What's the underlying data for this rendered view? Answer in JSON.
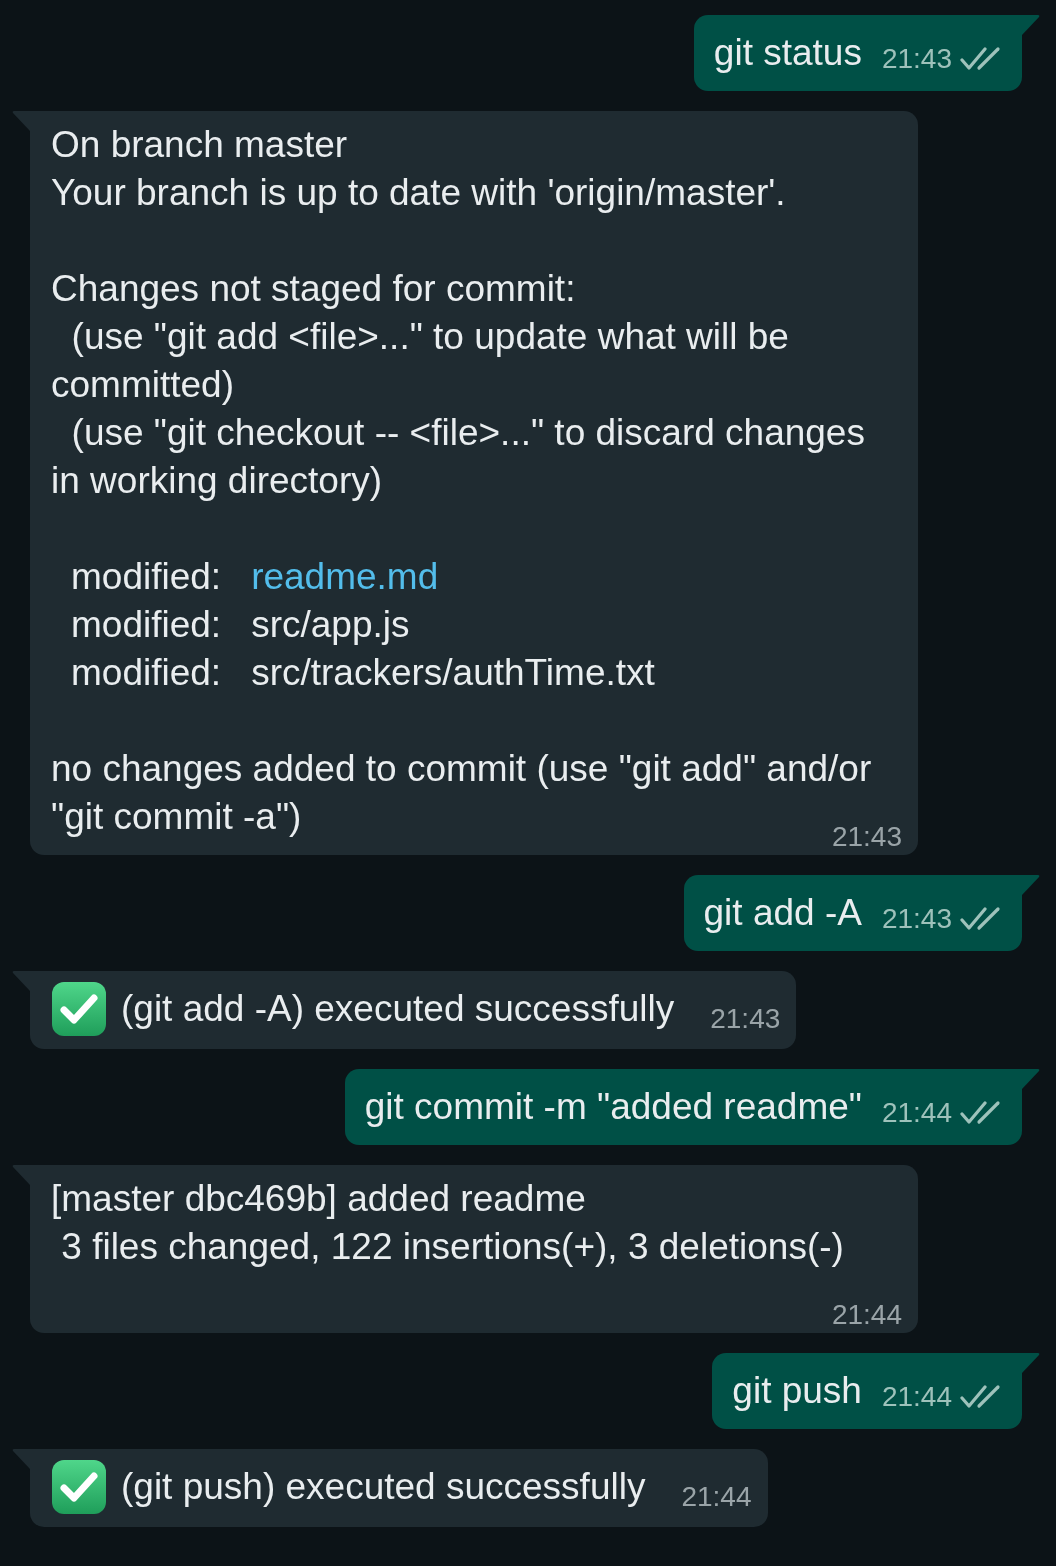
{
  "messages": [
    {
      "kind": "sent",
      "text": "git status",
      "time": "21:43",
      "read": false
    },
    {
      "kind": "received",
      "blocks": [
        {
          "kind": "text",
          "text": "On branch master\nYour branch is up to date with 'origin/master'."
        },
        {
          "kind": "text",
          "text": "Changes not staged for commit:\n  (use \"git add <file>...\" to update what will be committed)\n  (use \"git checkout -- <file>...\" to discard changes in working directory)"
        },
        {
          "kind": "files",
          "rows": [
            {
              "status": "modified:",
              "file": "readme.md",
              "link": true
            },
            {
              "status": "modified:",
              "file": "src/app.js",
              "link": false
            },
            {
              "status": "modified:",
              "file": "src/trackers/authTime.txt",
              "link": false
            }
          ]
        },
        {
          "kind": "text",
          "text": "no changes added to commit (use \"git add\" and/or \"git commit -a\")"
        }
      ],
      "time": "21:43"
    },
    {
      "kind": "sent",
      "text": "git add -A",
      "time": "21:43",
      "read": false
    },
    {
      "kind": "success",
      "text": "(git add -A) executed successfully",
      "time": "21:43"
    },
    {
      "kind": "sent",
      "text": "git commit -m \"added readme\"",
      "time": "21:44",
      "read": false
    },
    {
      "kind": "received",
      "blocks": [
        {
          "kind": "text",
          "text": "[master dbc469b] added readme\n 3 files changed, 122 insertions(+), 3 deletions(-)"
        }
      ],
      "time": "21:44"
    },
    {
      "kind": "sent",
      "text": "git push",
      "time": "21:44",
      "read": false
    },
    {
      "kind": "success",
      "text": "(git push) executed successfully",
      "time": "21:44"
    }
  ]
}
